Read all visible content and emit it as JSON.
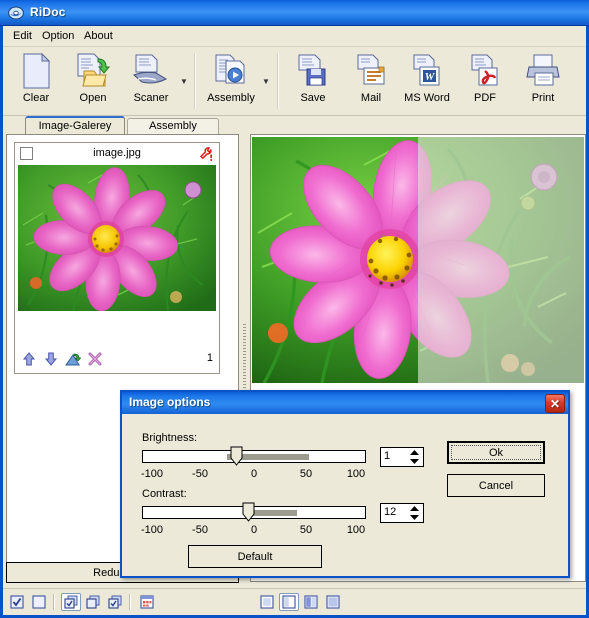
{
  "window": {
    "title": "RiDoc",
    "icon": "app-disc-icon"
  },
  "menu": {
    "items": [
      {
        "label": "Edit"
      },
      {
        "label": "Option"
      },
      {
        "label": "About"
      }
    ]
  },
  "toolbar": {
    "buttons": [
      {
        "label": "Clear",
        "icon": "blank-page-icon",
        "dropdown": false
      },
      {
        "label": "Open",
        "icon": "open-folder-icon",
        "dropdown": false
      },
      {
        "label": "Scaner",
        "icon": "scanner-icon",
        "dropdown": true
      },
      {
        "label": "Assembly",
        "icon": "assembly-play-icon",
        "dropdown": true
      },
      {
        "label": "Save",
        "icon": "floppy-save-icon",
        "dropdown": false
      },
      {
        "label": "Mail",
        "icon": "mail-icon",
        "dropdown": false
      },
      {
        "label": "MS Word",
        "icon": "word-icon",
        "dropdown": false
      },
      {
        "label": "PDF",
        "icon": "pdf-icon",
        "dropdown": false
      },
      {
        "label": "Print",
        "icon": "printer-icon",
        "dropdown": false
      }
    ]
  },
  "tabs": [
    {
      "label": "Image-Galerey",
      "active": true
    },
    {
      "label": "Assembly",
      "active": false
    }
  ],
  "gallery": {
    "thumbnail": {
      "filename": "image.jpg",
      "checked": false,
      "tool_icon": "red-wrench-warning-icon",
      "page_number": "1",
      "footer_buttons": [
        {
          "icon": "move-up-icon"
        },
        {
          "icon": "move-down-icon"
        },
        {
          "icon": "rotate-icon"
        },
        {
          "icon": "delete-x-icon"
        }
      ]
    },
    "reduce_button_label": "Reduce ima"
  },
  "dialog": {
    "title": "Image options",
    "close_label": "✕",
    "brightness": {
      "label": "Brightness:",
      "value": "1",
      "min": -100,
      "max": 100,
      "ticks": [
        "-100",
        "-50",
        "0",
        "50",
        "100"
      ]
    },
    "contrast": {
      "label": "Contrast:",
      "value": "12",
      "min": -100,
      "max": 100,
      "ticks": [
        "-100",
        "-50",
        "0",
        "50",
        "100"
      ]
    },
    "buttons": {
      "ok": "Ok",
      "cancel": "Cancel",
      "default": "Default"
    }
  },
  "statusbar": {
    "left_buttons": [
      {
        "icon": "check-all-icon",
        "selected": false
      },
      {
        "icon": "uncheck-all-icon",
        "selected": false
      },
      {
        "icon": "copy-checked-icon",
        "selected": true
      },
      {
        "icon": "copy-pages-icon",
        "selected": false
      },
      {
        "icon": "copy-check2-icon",
        "selected": false
      },
      {
        "icon": "grid-view-icon",
        "selected": false
      }
    ],
    "view_buttons": [
      {
        "icon": "view-single-icon",
        "selected": false
      },
      {
        "icon": "view-split-icon",
        "selected": true
      },
      {
        "icon": "view-half-icon",
        "selected": false
      },
      {
        "icon": "view-full-icon",
        "selected": false
      }
    ]
  },
  "colors": {
    "title_blue": "#1d74e8",
    "face": "#ece9d8",
    "accent_red": "#d63b25"
  }
}
